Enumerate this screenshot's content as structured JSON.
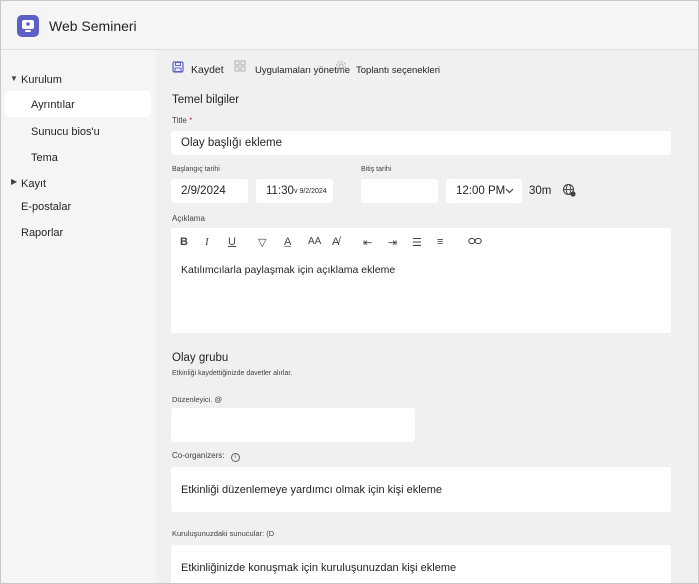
{
  "app": {
    "title": "Web Semineri"
  },
  "sidebar": {
    "groups": [
      {
        "label": "Kurulum"
      },
      {
        "label": "Kayıt"
      }
    ],
    "items": [
      {
        "label": "Ayrıntılar"
      },
      {
        "label": "Sunucu bios'u"
      },
      {
        "label": "Tema"
      },
      {
        "label": "E-postalar"
      },
      {
        "label": "Raporlar"
      }
    ]
  },
  "toolbar": {
    "save_label": "Kaydet",
    "apps_label": "Uygulamaları yönetme",
    "options_label": "Toplantı seçenekleri"
  },
  "basic": {
    "section_title": "Temel bilgiler",
    "title_label": "Title",
    "title_required": "*",
    "title_placeholder": "Olay başlığı ekleme",
    "start_date_label": "Başlangıç tarihi",
    "start_date": "2/9/2024",
    "start_time": "11:30",
    "start_time_hint": "v 9/2/2024",
    "end_date_label": "Bitiş tarihi",
    "end_time": "12:00 PM",
    "duration": "30m",
    "description_label": "Açıklama",
    "description_placeholder": "Katılımcılarla paylaşmak için açıklama ekleme"
  },
  "event_group": {
    "section_title": "Olay grubu",
    "subtitle": "Etkinliği kaydettiğinizde davetler alırlar.",
    "organizer_label": "Düzenleyici. @",
    "co_organizers_label": "Co-organizers:",
    "co_organizers_placeholder": "Etkinliği düzenlemeye yardımcı olmak için kişi ekleme",
    "presenters_label": "Kuruluşunuzdaki  sunucular: (D",
    "presenters_placeholder": "Etkinliğinizde konuşmak için kuruluşunuzdan kişi ekleme"
  },
  "colors": {
    "accent": "#5b5fc7",
    "required": "#c4314b"
  }
}
